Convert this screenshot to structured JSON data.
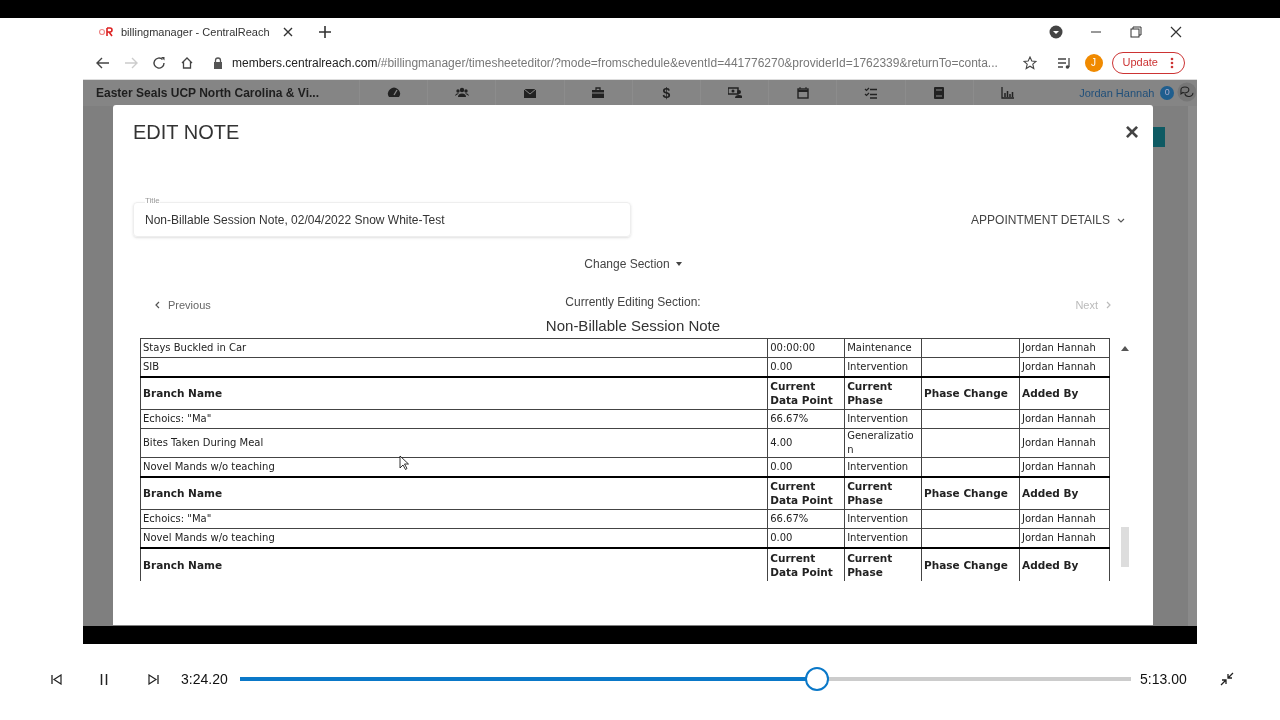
{
  "browser": {
    "tab_title": "billingmanager - CentralReach",
    "url_host": "members.centralreach.com",
    "url_rest": "/#billingmanager/timesheeteditor/?mode=fromschedule&eventId=441776270&providerId=1762339&returnTo=conta...",
    "profile_initial": "J",
    "update_label": "Update"
  },
  "app_header": {
    "org_name": "Easter Seals UCP North Carolina & Vi...",
    "nav_text": "$",
    "user_name": "Jordan Hannah",
    "notification_count": "0"
  },
  "modal": {
    "title": "EDIT NOTE",
    "close": "×",
    "title_field": {
      "label": "Title",
      "value": "Non-Billable Session Note, 02/04/2022 Snow White-Test"
    },
    "appointment_details": "APPOINTMENT DETAILS",
    "change_section": "Change Section",
    "previous": "Previous",
    "next": {
      "label": "Next",
      "disabled": true
    },
    "editing_caption": "Currently Editing Section:",
    "section_name": "Non-Billable Session Note",
    "rows": [
      {
        "kind": "data",
        "cells": [
          "Stays Buckled in Car",
          "00:00:00",
          "Maintenance",
          "",
          "Jordan Hannah"
        ]
      },
      {
        "kind": "data",
        "cells": [
          "SIB",
          "0.00",
          "Intervention",
          "",
          "Jordan Hannah"
        ]
      },
      {
        "kind": "header",
        "cells": [
          "Branch Name",
          "Current Data Point",
          "Current Phase",
          "Phase Change",
          "Added By"
        ]
      },
      {
        "kind": "data",
        "cells": [
          "Echoics: \"Ma\"",
          "66.67%",
          "Intervention",
          "",
          "Jordan Hannah"
        ]
      },
      {
        "kind": "data",
        "cells": [
          "Bites Taken During Meal",
          "4.00",
          "Generalizatio n",
          "",
          "Jordan Hannah"
        ]
      },
      {
        "kind": "data",
        "cells": [
          "Novel Mands w/o teaching",
          "0.00",
          "Intervention",
          "",
          "Jordan Hannah"
        ]
      },
      {
        "kind": "header",
        "cells": [
          "Branch Name",
          "Current Data Point",
          "Current Phase",
          "Phase Change",
          "Added By"
        ]
      },
      {
        "kind": "data",
        "cells": [
          "Echoics: \"Ma\"",
          "66.67%",
          "Intervention",
          "",
          "Jordan Hannah"
        ]
      },
      {
        "kind": "data",
        "cells": [
          "Novel Mands w/o teaching",
          "0.00",
          "Intervention",
          "",
          "Jordan Hannah"
        ]
      },
      {
        "kind": "header",
        "cells": [
          "Branch Name",
          "Current Data Point",
          "Current Phase",
          "Phase Change",
          "Added By"
        ]
      }
    ]
  },
  "player": {
    "elapsed": "3:24.20",
    "duration": "5:13.00",
    "level": 0.648,
    "playing": true
  }
}
